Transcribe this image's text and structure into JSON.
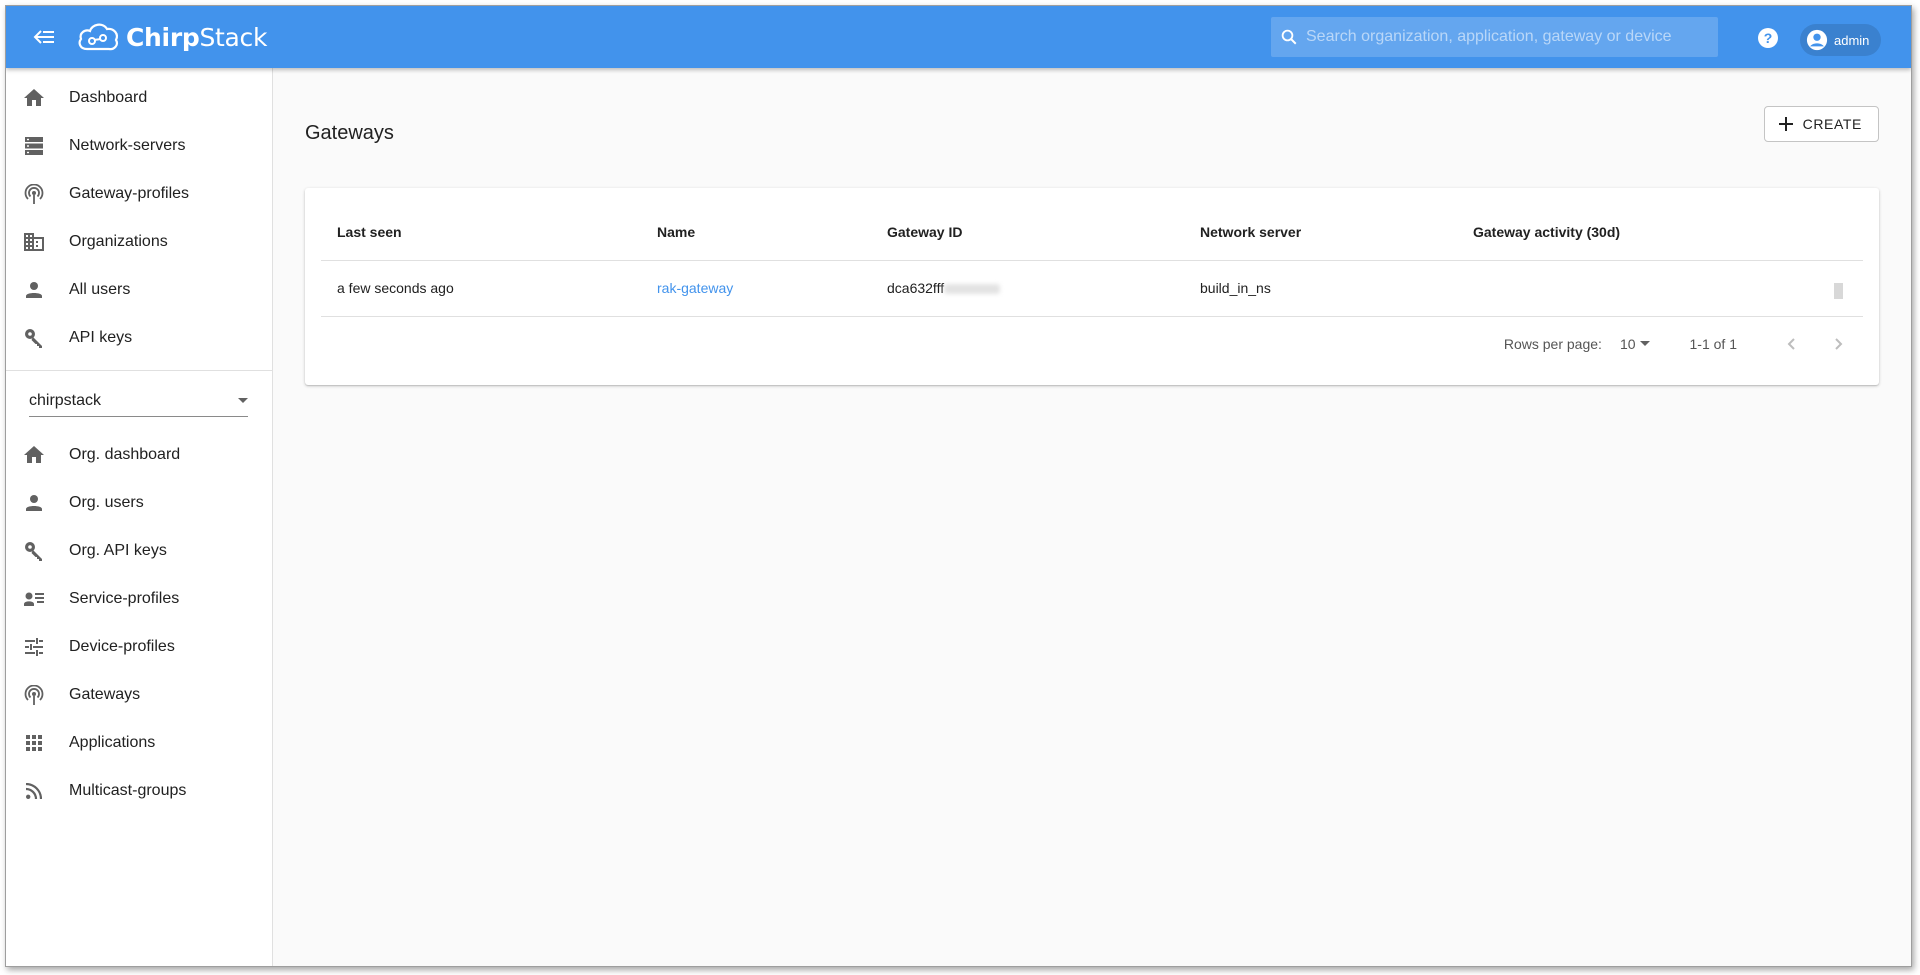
{
  "app": {
    "brand": "ChirpStack",
    "brand_bold": "Chirp",
    "brand_rest": "Stack",
    "colors": {
      "appbar": "#4293ec",
      "link": "#4293ec"
    }
  },
  "header": {
    "menu_icon": "menu-collapse-icon",
    "search": {
      "placeholder": "Search organization, application, gateway or device",
      "value": ""
    },
    "help_icon": "help-circle-icon",
    "user": {
      "name": "admin",
      "icon": "account-circle-icon"
    }
  },
  "sidebar": {
    "global_items": [
      {
        "label": "Dashboard",
        "icon": "home-icon"
      },
      {
        "label": "Network-servers",
        "icon": "server-icon"
      },
      {
        "label": "Gateway-profiles",
        "icon": "radio-tower-icon"
      },
      {
        "label": "Organizations",
        "icon": "domain-icon"
      },
      {
        "label": "All users",
        "icon": "account-icon"
      },
      {
        "label": "API keys",
        "icon": "key-icon"
      }
    ],
    "org_select": {
      "value": "chirpstack"
    },
    "org_items": [
      {
        "label": "Org. dashboard",
        "icon": "home-icon"
      },
      {
        "label": "Org. users",
        "icon": "account-icon"
      },
      {
        "label": "Org. API keys",
        "icon": "key-icon"
      },
      {
        "label": "Service-profiles",
        "icon": "account-details-icon"
      },
      {
        "label": "Device-profiles",
        "icon": "tune-icon"
      },
      {
        "label": "Gateways",
        "icon": "radio-tower-icon"
      },
      {
        "label": "Applications",
        "icon": "apps-icon"
      },
      {
        "label": "Multicast-groups",
        "icon": "rss-icon"
      }
    ]
  },
  "main": {
    "title": "Gateways",
    "create_label": "CREATE",
    "table": {
      "columns": [
        "Last seen",
        "Name",
        "Gateway ID",
        "Network server",
        "Gateway activity (30d)"
      ],
      "rows": [
        {
          "last_seen": "a few seconds ago",
          "name": "rak-gateway",
          "gateway_id": "dca632fff",
          "network_server": "build_in_ns"
        }
      ]
    },
    "pagination": {
      "rows_per_page_label": "Rows per page:",
      "rows_per_page": "10",
      "range": "1-1 of 1"
    }
  }
}
